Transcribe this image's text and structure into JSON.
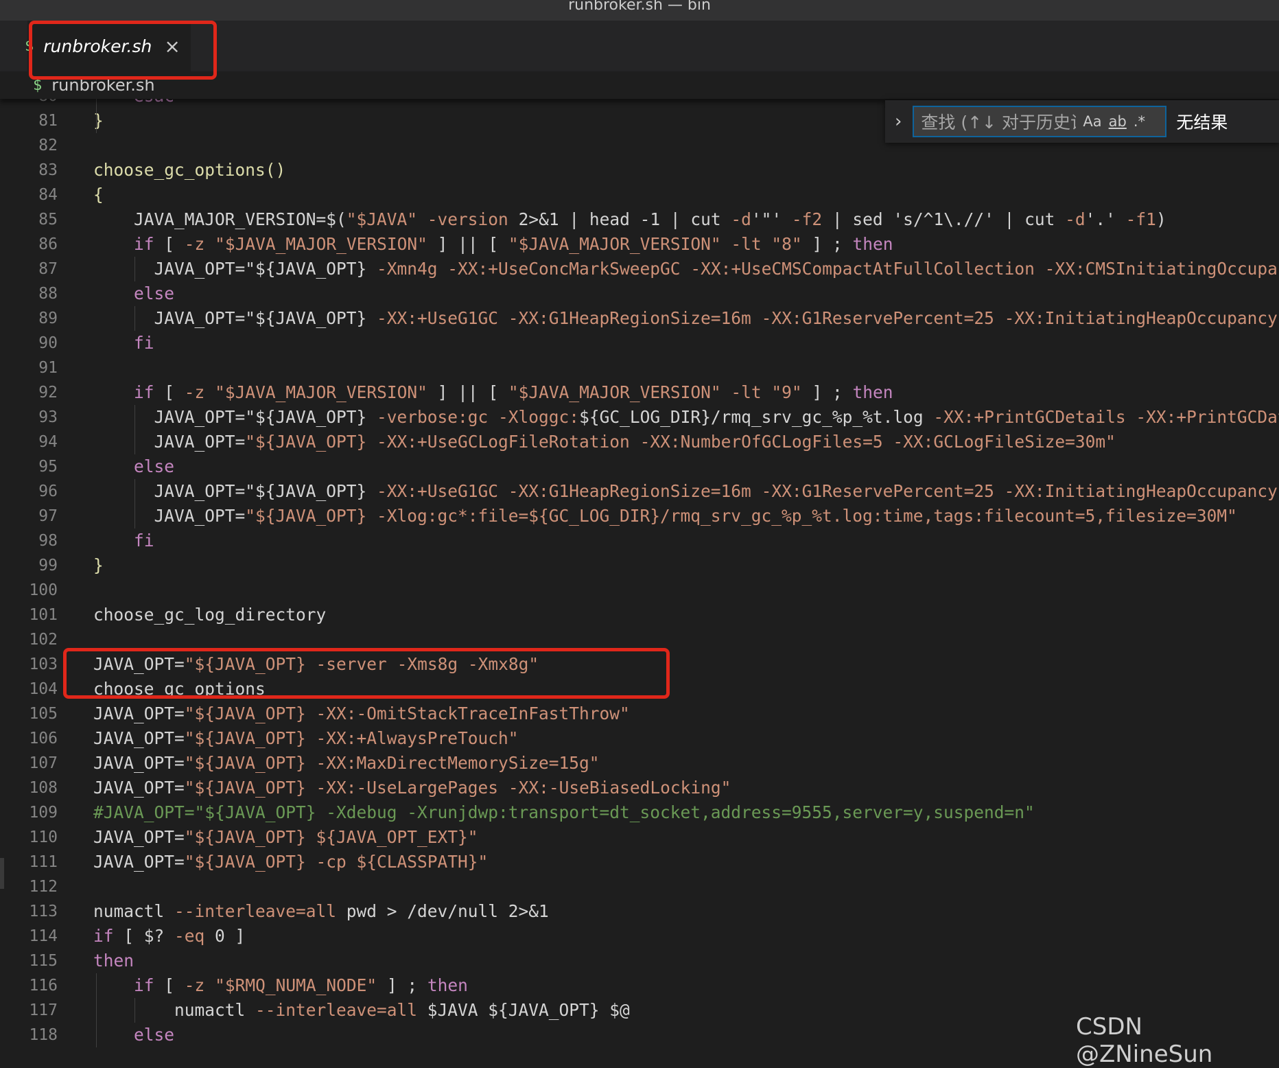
{
  "window": {
    "title": "runbroker.sh — bin"
  },
  "tab": {
    "icon": "$",
    "label": "runbroker.sh",
    "close_icon": "×"
  },
  "breadcrumb": {
    "icon": "$",
    "label": "runbroker.sh"
  },
  "find": {
    "placeholder": "查找 (↑↓ 对于历史记录)",
    "match_case": "Aa",
    "whole_word": "ab",
    "regex": ".*",
    "result": "无结果"
  },
  "watermark": "CSDN @ZNineSun",
  "colors": {
    "keyword": "#c586c0",
    "variable": "#9cdcfe",
    "string": "#ce9178",
    "function": "#dcdcaa",
    "comment": "#6a9955",
    "bracket": "#ffd700",
    "annotation": "#e0271a"
  },
  "lines": [
    {
      "num": "80",
      "text": "    esac"
    },
    {
      "num": "81",
      "text": "}"
    },
    {
      "num": "82",
      "text": ""
    },
    {
      "num": "83",
      "text": "choose_gc_options()"
    },
    {
      "num": "84",
      "text": "{"
    },
    {
      "num": "85",
      "text": "    JAVA_MAJOR_VERSION=$(\"$JAVA\" -version 2>&1 | head -1 | cut -d'\"' -f2 | sed 's/^1\\.//' | cut -d'.' -f1)"
    },
    {
      "num": "86",
      "text": "    if [ -z \"$JAVA_MAJOR_VERSION\" ] || [ \"$JAVA_MAJOR_VERSION\" -lt \"8\" ] ; then"
    },
    {
      "num": "87",
      "text": "      JAVA_OPT=\"${JAVA_OPT} -Xmn4g -XX:+UseConcMarkSweepGC -XX:+UseCMSCompactAtFullCollection -XX:CMSInitiatingOccupancy"
    },
    {
      "num": "88",
      "text": "    else"
    },
    {
      "num": "89",
      "text": "      JAVA_OPT=\"${JAVA_OPT} -XX:+UseG1GC -XX:G1HeapRegionSize=16m -XX:G1ReservePercent=25 -XX:InitiatingHeapOccupancyPer"
    },
    {
      "num": "90",
      "text": "    fi"
    },
    {
      "num": "91",
      "text": ""
    },
    {
      "num": "92",
      "text": "    if [ -z \"$JAVA_MAJOR_VERSION\" ] || [ \"$JAVA_MAJOR_VERSION\" -lt \"9\" ] ; then"
    },
    {
      "num": "93",
      "text": "      JAVA_OPT=\"${JAVA_OPT} -verbose:gc -Xloggc:${GC_LOG_DIR}/rmq_srv_gc_%p_%t.log -XX:+PrintGCDetails -XX:+PrintGCDateS"
    },
    {
      "num": "94",
      "text": "      JAVA_OPT=\"${JAVA_OPT} -XX:+UseGCLogFileRotation -XX:NumberOfGCLogFiles=5 -XX:GCLogFileSize=30m\""
    },
    {
      "num": "95",
      "text": "    else"
    },
    {
      "num": "96",
      "text": "      JAVA_OPT=\"${JAVA_OPT} -XX:+UseG1GC -XX:G1HeapRegionSize=16m -XX:G1ReservePercent=25 -XX:InitiatingHeapOccupancyPer"
    },
    {
      "num": "97",
      "text": "      JAVA_OPT=\"${JAVA_OPT} -Xlog:gc*:file=${GC_LOG_DIR}/rmq_srv_gc_%p_%t.log:time,tags:filecount=5,filesize=30M\""
    },
    {
      "num": "98",
      "text": "    fi"
    },
    {
      "num": "99",
      "text": "}"
    },
    {
      "num": "100",
      "text": ""
    },
    {
      "num": "101",
      "text": "choose_gc_log_directory"
    },
    {
      "num": "102",
      "text": ""
    },
    {
      "num": "103",
      "text": "JAVA_OPT=\"${JAVA_OPT} -server -Xms8g -Xmx8g\""
    },
    {
      "num": "104",
      "text": "choose_gc_options"
    },
    {
      "num": "105",
      "text": "JAVA_OPT=\"${JAVA_OPT} -XX:-OmitStackTraceInFastThrow\""
    },
    {
      "num": "106",
      "text": "JAVA_OPT=\"${JAVA_OPT} -XX:+AlwaysPreTouch\""
    },
    {
      "num": "107",
      "text": "JAVA_OPT=\"${JAVA_OPT} -XX:MaxDirectMemorySize=15g\""
    },
    {
      "num": "108",
      "text": "JAVA_OPT=\"${JAVA_OPT} -XX:-UseLargePages -XX:-UseBiasedLocking\""
    },
    {
      "num": "109",
      "text": "#JAVA_OPT=\"${JAVA_OPT} -Xdebug -Xrunjdwp:transport=dt_socket,address=9555,server=y,suspend=n\""
    },
    {
      "num": "110",
      "text": "JAVA_OPT=\"${JAVA_OPT} ${JAVA_OPT_EXT}\""
    },
    {
      "num": "111",
      "text": "JAVA_OPT=\"${JAVA_OPT} -cp ${CLASSPATH}\""
    },
    {
      "num": "112",
      "text": ""
    },
    {
      "num": "113",
      "text": "numactl --interleave=all pwd > /dev/null 2>&1"
    },
    {
      "num": "114",
      "text": "if [ $? -eq 0 ]"
    },
    {
      "num": "115",
      "text": "then"
    },
    {
      "num": "116",
      "text": "    if [ -z \"$RMQ_NUMA_NODE\" ] ; then"
    },
    {
      "num": "117",
      "text": "        numactl --interleave=all $JAVA ${JAVA_OPT} $@"
    },
    {
      "num": "118",
      "text": "    else"
    }
  ]
}
